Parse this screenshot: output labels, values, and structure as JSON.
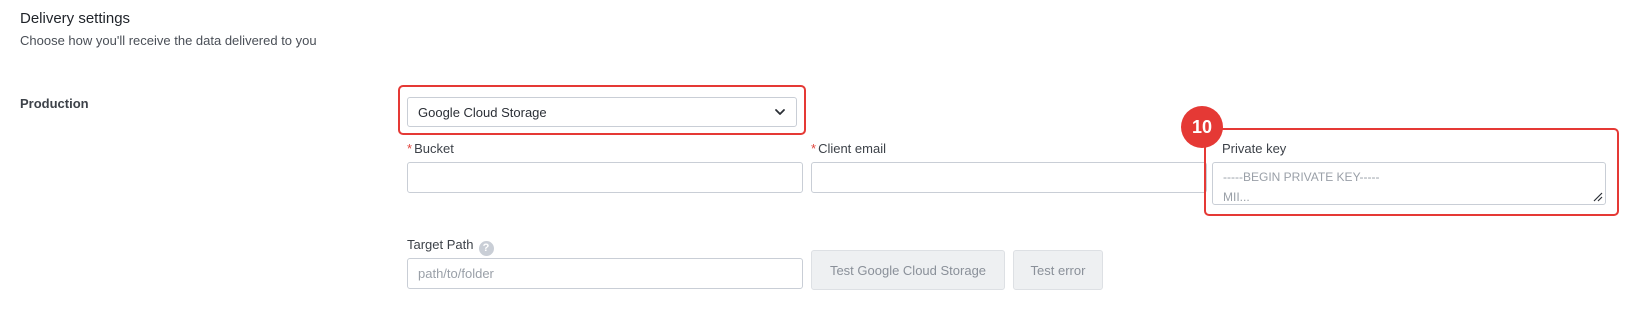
{
  "header": {
    "title": "Delivery settings",
    "subtitle": "Choose how you'll receive the data delivered to you"
  },
  "section": {
    "label": "Production"
  },
  "provider_select": {
    "value": "Google Cloud Storage"
  },
  "fields": {
    "bucket": {
      "label": "Bucket",
      "required": true,
      "value": ""
    },
    "client_email": {
      "label": "Client email",
      "required": true,
      "value": ""
    },
    "private_key": {
      "label": "Private key",
      "placeholder_line1": "-----BEGIN PRIVATE KEY-----",
      "placeholder_line2": "MII..."
    },
    "target_path": {
      "label": "Target Path",
      "placeholder": "path/to/folder"
    }
  },
  "buttons": {
    "test_storage": "Test Google Cloud Storage",
    "test_error": "Test error"
  },
  "annotation": {
    "marker": "10"
  },
  "colors": {
    "highlight": "#e53935",
    "required": "#e0453d"
  }
}
